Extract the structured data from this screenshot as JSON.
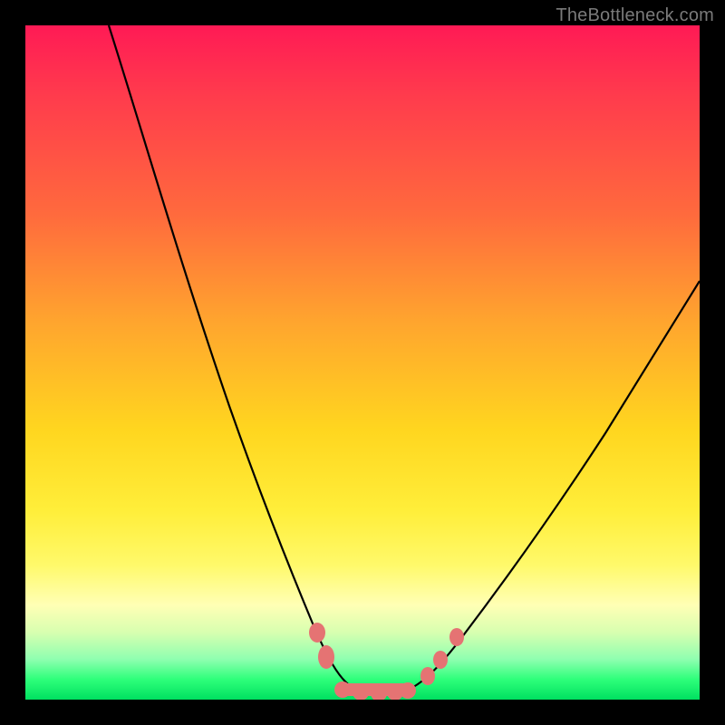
{
  "watermark": "TheBottleneck.com",
  "colors": {
    "bead": "#e57373",
    "curve": "#000000",
    "frame": "#000000"
  },
  "chart_data": {
    "type": "line",
    "title": "",
    "xlabel": "",
    "ylabel": "",
    "xlim": [
      0,
      100
    ],
    "ylim": [
      0,
      100
    ],
    "grid": false,
    "legend": false,
    "note": "V-shaped bottleneck curve on rainbow gradient. x is approximate horizontal position (0–100 left→right), y is approximate vertical position (0 at bottom → 100 at top). Minimum (flat region) around x≈47–57 at y≈2. Left branch starts near top-left (x≈12, y≈100) and descends steeply; right branch rises from the flat region to about (x≈100, y≈62).",
    "series": [
      {
        "name": "curve",
        "x": [
          12,
          16,
          20,
          24,
          28,
          32,
          35,
          38,
          41,
          43,
          45,
          47,
          50,
          53,
          55,
          57,
          60,
          64,
          70,
          78,
          88,
          100
        ],
        "y": [
          100,
          88,
          76,
          64,
          52,
          40,
          30,
          22,
          15,
          10,
          6,
          3,
          2,
          2,
          3,
          4,
          7,
          12,
          22,
          34,
          48,
          62
        ]
      }
    ],
    "markers": {
      "name": "beads",
      "note": "Salmon circular markers near the bottom of the V.",
      "x": [
        42.5,
        44,
        47,
        50,
        53,
        56,
        58.5,
        61,
        63.5
      ],
      "y": [
        10,
        6,
        3,
        2,
        2,
        3,
        6,
        10,
        15
      ]
    }
  }
}
